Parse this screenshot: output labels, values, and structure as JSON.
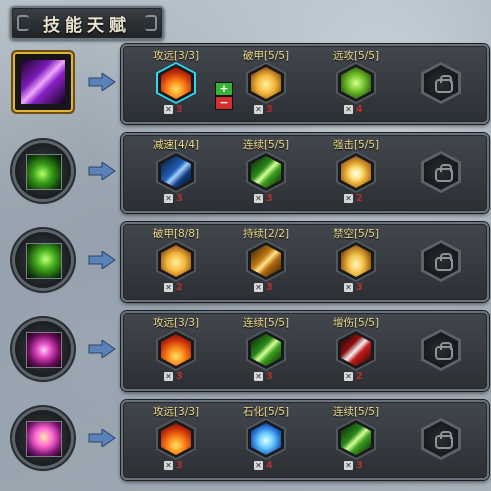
{
  "title": "技能天赋",
  "rows": [
    {
      "skill_icon": "purple-arcane-skill-icon",
      "selected": true,
      "talents": [
        {
          "label": "攻远[3/3]",
          "cost": "3",
          "icon": "fire-icon",
          "selected": true
        },
        {
          "label": "破甲[5/5]",
          "cost": "3",
          "icon": "gold-shard-icon"
        },
        {
          "label": "远攻[5/5]",
          "cost": "4",
          "icon": "green-bow-icon"
        }
      ]
    },
    {
      "skill_icon": "green-vine-skill-icon",
      "talents": [
        {
          "label": "减速[4/4]",
          "cost": "3",
          "icon": "blue-slash-icon"
        },
        {
          "label": "连续[5/5]",
          "cost": "3",
          "icon": "green-streak-icon"
        },
        {
          "label": "强击[5/5]",
          "cost": "2",
          "icon": "golden-burst-icon"
        }
      ]
    },
    {
      "skill_icon": "green-vine-skill-icon-2",
      "talents": [
        {
          "label": "破甲[8/8]",
          "cost": "2",
          "icon": "gold-shard-icon"
        },
        {
          "label": "持续[2/2]",
          "cost": "3",
          "icon": "gold-streak-icon"
        },
        {
          "label": "禁空[5/5]",
          "cost": "3",
          "icon": "golden-wave-icon"
        }
      ]
    },
    {
      "skill_icon": "pink-moon-skill-icon",
      "talents": [
        {
          "label": "攻远[3/3]",
          "cost": "3",
          "icon": "fire-icon"
        },
        {
          "label": "连续[5/5]",
          "cost": "3",
          "icon": "green-streak-icon"
        },
        {
          "label": "增伤[5/5]",
          "cost": "2",
          "icon": "red-blade-icon"
        }
      ]
    },
    {
      "skill_icon": "pink-butterfly-skill-icon",
      "talents": [
        {
          "label": "攻远[3/3]",
          "cost": "3",
          "icon": "fire-icon"
        },
        {
          "label": "石化[5/5]",
          "cost": "4",
          "icon": "ice-crystal-icon"
        },
        {
          "label": "连续[5/5]",
          "cost": "3",
          "icon": "green-streak-icon"
        }
      ]
    }
  ],
  "controls": {
    "plus": "+",
    "minus": "−"
  },
  "colors": {
    "label": "#f2dd8c",
    "cost": "#b23030",
    "selected_hex": "#2fd6f2",
    "selected_skill": "#e0b43a"
  }
}
